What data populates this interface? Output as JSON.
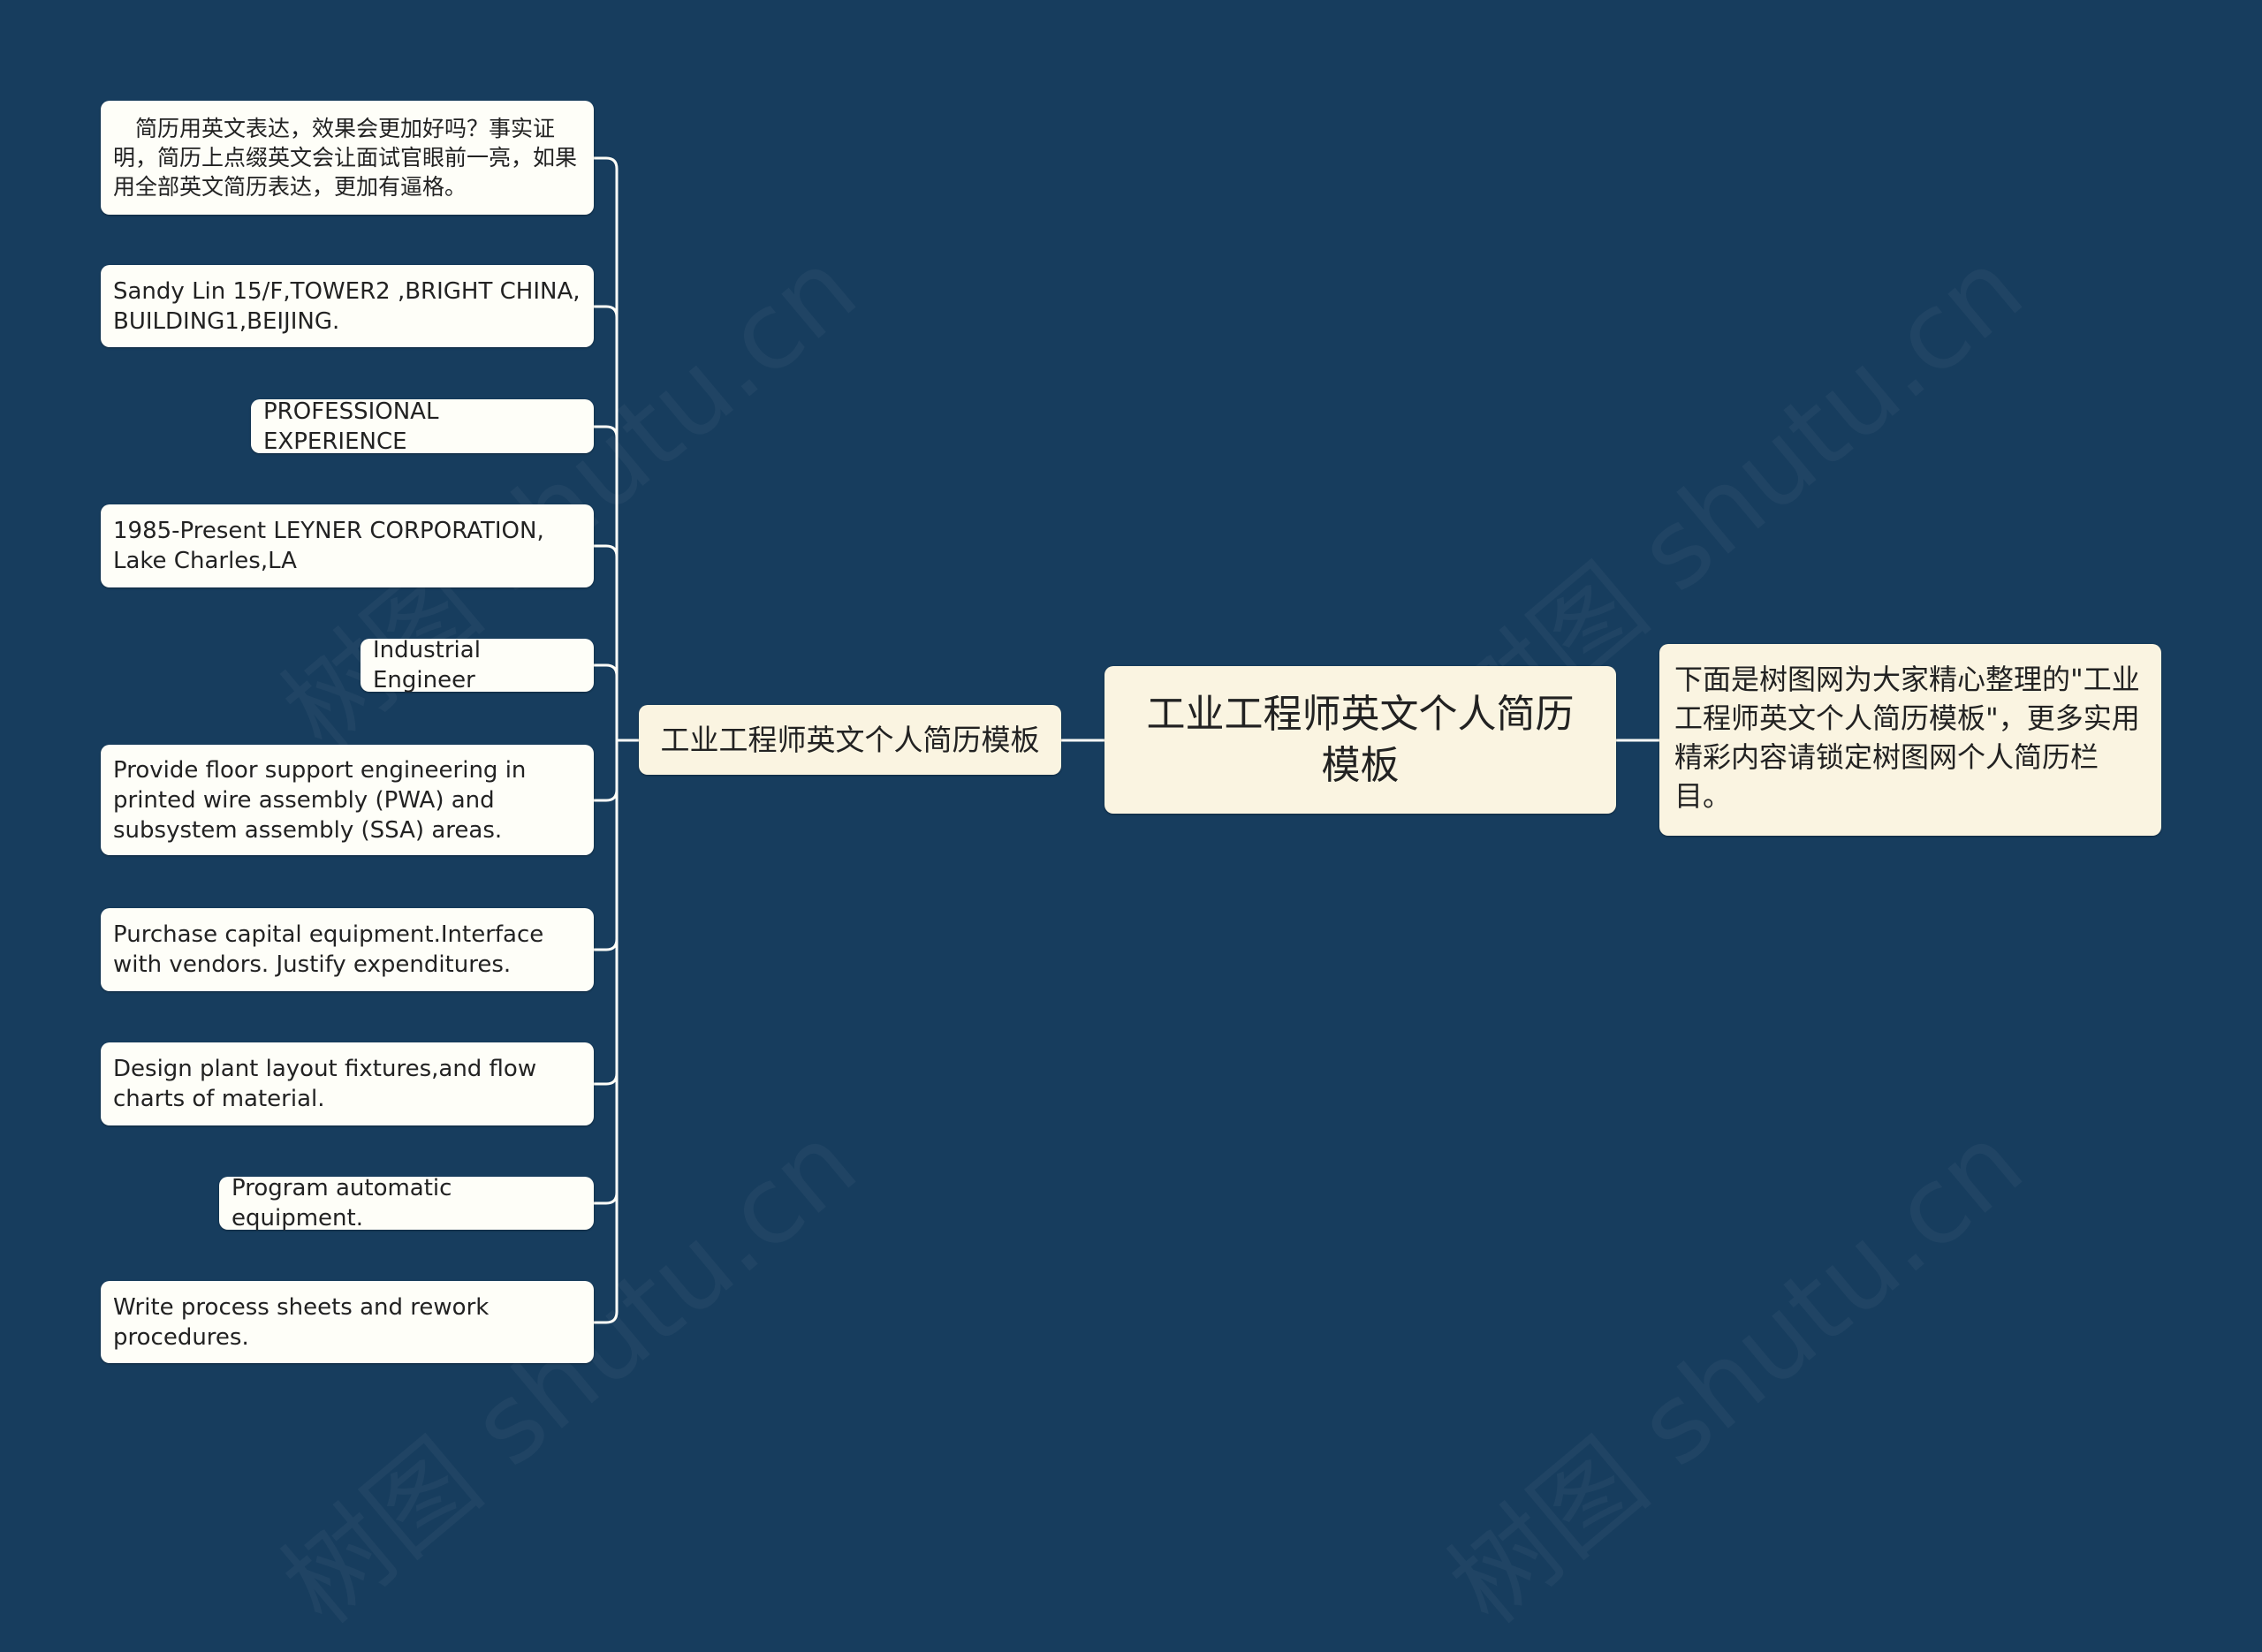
{
  "colors": {
    "background": "#173d5e",
    "root_fill": "#faf4e1",
    "leaf_fill": "#fefef8",
    "connector": "#fefef8",
    "text": "#222222"
  },
  "root": {
    "label": "工业工程师英文个人简历模板"
  },
  "note": {
    "text": "下面是树图网为大家精心整理的\"工业工程师英文个人简历模板\"，更多实用精彩内容请锁定树图网个人简历栏目。"
  },
  "branch": {
    "label": "工业工程师英文个人简历模板",
    "leaves": [
      {
        "text": "　简历用英文表达，效果会更加好吗？事实证明，简历上点缀英文会让面试官眼前一亮，如果用全部英文简历表达，更加有逼格。"
      },
      {
        "text": "Sandy Lin 15/F,TOWER2 ,BRIGHT CHINA, BUILDING1,BEIJING."
      },
      {
        "text": "PROFESSIONAL EXPERIENCE"
      },
      {
        "text": "1985-Present LEYNER CORPORATION, Lake Charles,LA"
      },
      {
        "text": "Industrial Engineer"
      },
      {
        "text": "Provide floor support engineering in printed wire assembly (PWA) and subsystem assembly (SSA) areas."
      },
      {
        "text": "Purchase capital equipment.Interface with vendors. Justify expenditures."
      },
      {
        "text": "Design plant layout fixtures,and flow charts of material."
      },
      {
        "text": "Program automatic equipment."
      },
      {
        "text": "Write process sheets and rework procedures."
      }
    ]
  },
  "watermark": {
    "text": "树图 shutu.cn"
  }
}
